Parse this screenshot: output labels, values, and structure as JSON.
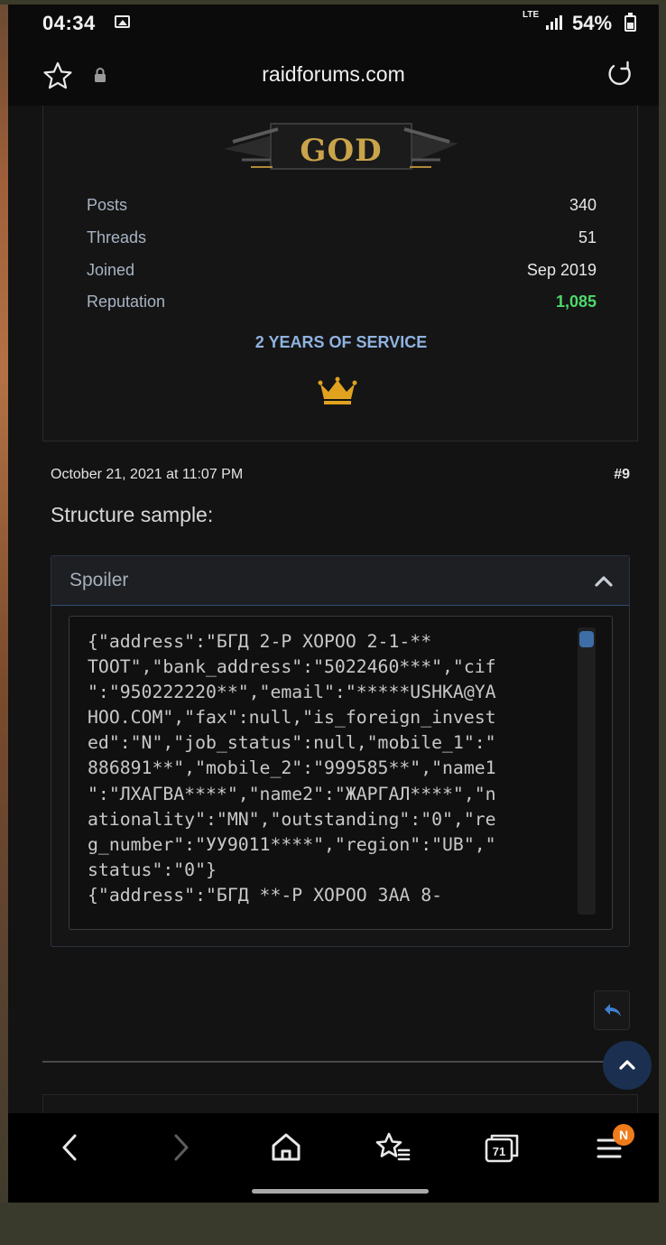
{
  "status_bar": {
    "time": "04:34",
    "network": "LTE",
    "battery": "54%"
  },
  "browser": {
    "url": "raidforums.com"
  },
  "profile": {
    "rank": "GOD",
    "stats": [
      {
        "label": "Posts",
        "value": "340"
      },
      {
        "label": "Threads",
        "value": "51"
      },
      {
        "label": "Joined",
        "value": "Sep 2019"
      },
      {
        "label": "Reputation",
        "value": "1,085"
      }
    ],
    "service": "2 YEARS OF SERVICE"
  },
  "post": {
    "date": "October 21, 2021 at 11:07 PM",
    "number": "#9",
    "text": "Structure sample:",
    "spoiler_label": "Spoiler",
    "code_lines": [
      "{\"address\":\"БГД 2-Р ХОРОО 2-1-**",
      "ТООТ\",\"bank_address\":\"5022460***\",\"cif",
      "\":\"950222220**\",\"email\":\"*****USHKA@YA",
      "HOO.COM\",\"fax\":null,\"is_foreign_invest",
      "ed\":\"N\",\"job_status\":null,\"mobile_1\":\"",
      "886891**\",\"mobile_2\":\"999585**\",\"name1",
      "\":\"ЛХАГВА****\",\"name2\":\"ЖАРГАЛ****\",\"n",
      "ationality\":\"MN\",\"outstanding\":\"0\",\"re",
      "g_number\":\"УУ9011****\",\"region\":\"UB\",\"",
      "status\":\"0\"}",
      "{\"address\":\"БГД **-Р ХОРОО ЗАА 8-"
    ]
  },
  "nav": {
    "tabs_count": "71",
    "menu_badge": "N"
  },
  "colors": {
    "accent_gold": "#c9a44a",
    "reputation_green": "#4cd96a",
    "service_blue": "#8fb3e0",
    "badge_orange": "#ef7b1a"
  }
}
